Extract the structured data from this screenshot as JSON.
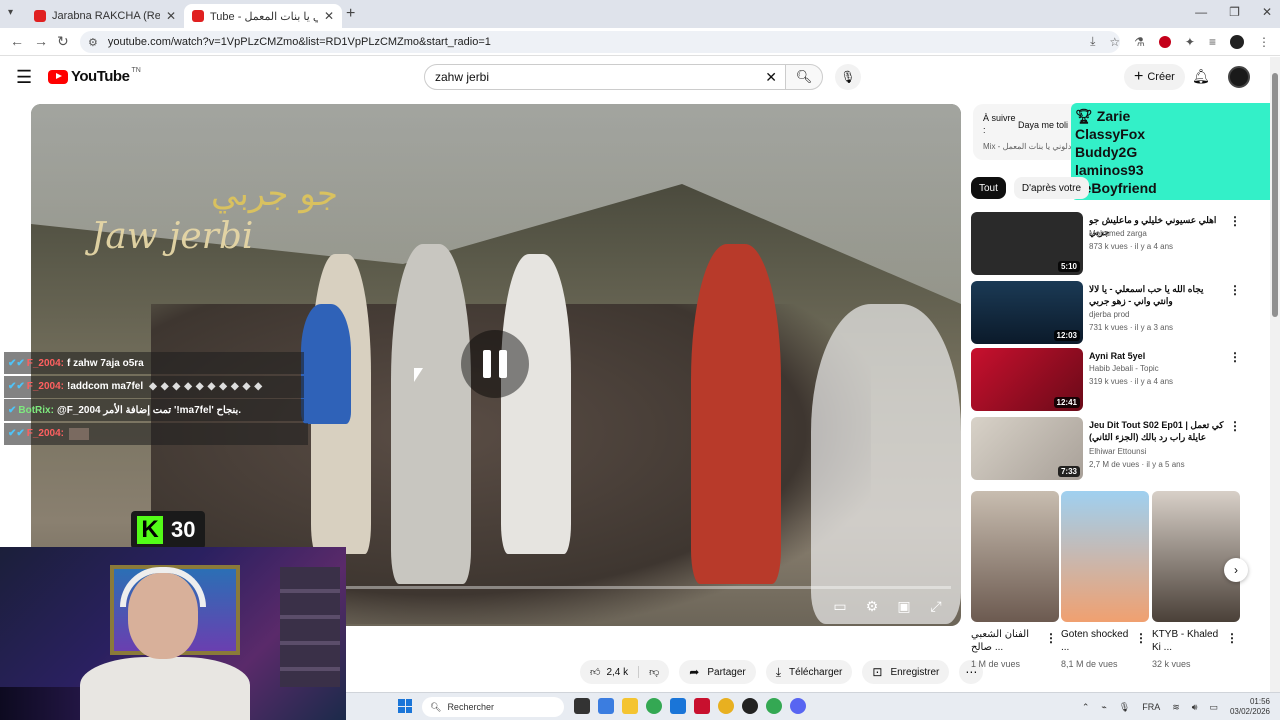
{
  "browser": {
    "tabs": [
      {
        "title": "Jarabna RAKCHA (Resto Psyco"
      },
      {
        "title": "Tube - دلوني يا بنات المعمل"
      }
    ],
    "url": "youtube.com/watch?v=1VpPLzCMZmo&list=RD1VpPLzCMZmo&start_radio=1",
    "new_tab": "+",
    "win_min": "—",
    "win_max": "❐",
    "win_close": "✕"
  },
  "yt": {
    "logo_word": "YouTube",
    "logo_tn": "TN",
    "search_value": "zahw jerbi",
    "create_label": "Créer"
  },
  "player": {
    "watermark_ar": "جو جربي",
    "watermark_en": "Jaw jerbi"
  },
  "chat": [
    {
      "user": "F_2004:",
      "message": "f zahw 7aja o5ra"
    },
    {
      "user": "F_2004:",
      "message": "!addcom ma7fel"
    },
    {
      "user": "BotRix:",
      "message": "@F_2004 تمت إضافة الأمر '!ma7fel' بنجاح."
    },
    {
      "user": "F_2004:",
      "message": ""
    }
  ],
  "kick": {
    "logo": "K",
    "count": "30"
  },
  "actions": {
    "likes": "2,4 k",
    "share": "Partager",
    "download": "Télécharger",
    "save": "Enregistrer"
  },
  "upnext": {
    "label": "À suivre :",
    "title": "Daya me toli",
    "mix": "Mix - دلوني يا بنات المعمل"
  },
  "overlay_names": [
    "Zarie",
    "ClassyFox",
    "Buddy2G",
    "laminos93",
    "LeBoyfriend"
  ],
  "chips": [
    "Tout",
    "D'après votre"
  ],
  "videos": [
    {
      "title": "اهلي عسيوني خليلي و ماعليش جو جربي",
      "channel": "Mohamed zarga",
      "meta": "873 k vues · il y a 4 ans",
      "duration": "5:10",
      "color": "#2a2a2a"
    },
    {
      "title": "يجاه الله يا حب اسمعلي - يا لالا وانتي واني - زهو جربي",
      "channel": "djerba prod",
      "meta": "731 k vues · il y a 3 ans",
      "duration": "12:03",
      "color": "#1b3a55"
    },
    {
      "title": "Ayni Rat 5yel",
      "channel": "Habib Jebali - Topic",
      "meta": "319 k vues · il y a 4 ans",
      "duration": "12:41",
      "color": "#9a1026"
    },
    {
      "title": "Jeu Dit Tout S02 Ep01 | كي تعمل عايلة راب رد بالك (الجزء الثاني)",
      "channel": "Elhiwar Ettounsi",
      "meta": "2,7 M de vues · il y a 5 ans",
      "duration": "7:33",
      "color": "#c7c0b5"
    }
  ],
  "shorts": [
    {
      "title": "الفنان الشعبي صالح ...",
      "views": "1 M de vues",
      "color": "#8c7a70"
    },
    {
      "title": "Goten shocked ...",
      "views": "8,1 M de vues",
      "color": "#7fb6e0"
    },
    {
      "title": "KTYB - Khaled Ki ...",
      "views": "32 k vues",
      "color": "#5a5048"
    }
  ],
  "taskbar": {
    "search": "Rechercher",
    "lang": "FRA",
    "time": "01:56",
    "date": "03/02/2026"
  }
}
